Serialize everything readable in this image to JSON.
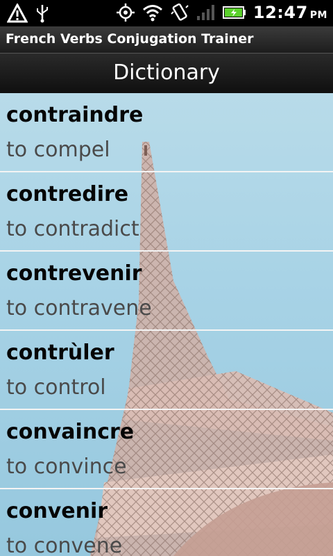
{
  "status_bar": {
    "time": "12:47",
    "ampm": "PM",
    "left_icons": [
      "warning-icon",
      "usb-icon"
    ],
    "right_icons": [
      "gps-icon",
      "wifi-icon",
      "vibrate-icon",
      "signal-icon",
      "battery-icon"
    ]
  },
  "app_title": "French Verbs Conjugation Trainer",
  "screen_title": "Dictionary",
  "entries": [
    {
      "verb": "contraindre",
      "translation": "to compel"
    },
    {
      "verb": "contredire",
      "translation": "to contradict"
    },
    {
      "verb": "contrevenir",
      "translation": "to contravene"
    },
    {
      "verb": "contrùler",
      "translation": "to control"
    },
    {
      "verb": "convaincre",
      "translation": "to convince"
    },
    {
      "verb": "convenir",
      "translation": "to convene"
    }
  ]
}
